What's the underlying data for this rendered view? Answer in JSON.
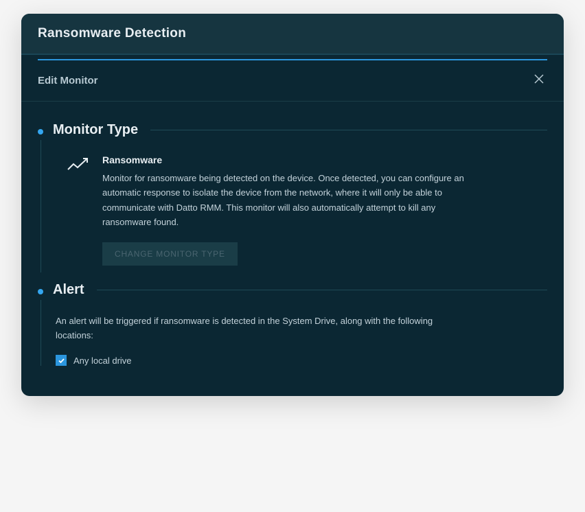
{
  "header": {
    "title": "Ransomware Detection"
  },
  "subheader": {
    "title": "Edit Monitor"
  },
  "sections": {
    "monitorType": {
      "title": "Monitor Type",
      "item": {
        "name": "Ransomware",
        "description": "Monitor for ransomware being detected on the device. Once detected, you can configure an automatic response to isolate the device from the network, where it will only be able to communicate with Datto RMM. This monitor will also automatically attempt to kill any ransomware found.",
        "changeButton": "CHANGE MONITOR TYPE"
      }
    },
    "alert": {
      "title": "Alert",
      "description": "An alert will be triggered if ransomware is detected in the System Drive, along with the following locations:",
      "options": [
        {
          "label": "Any local drive",
          "checked": true
        }
      ]
    }
  }
}
